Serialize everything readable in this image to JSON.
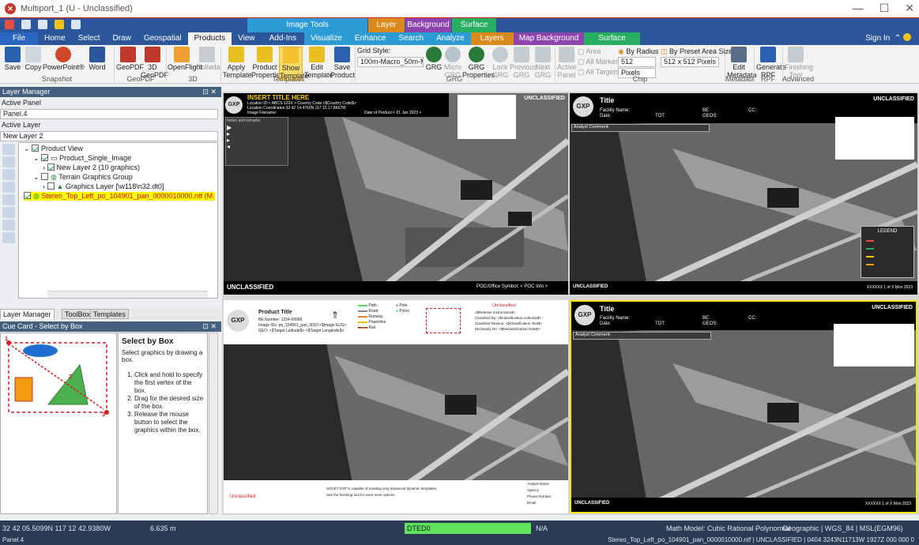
{
  "app": {
    "title": "Multiport_1 (U - Unclassified)"
  },
  "context_groups": [
    {
      "label": "Image Tools",
      "color": "#2d9cd6"
    },
    {
      "label": "Layer Tools",
      "color": "#d98a1a"
    },
    {
      "label": "Background Tools",
      "color": "#8e44ad"
    },
    {
      "label": "Surface Tools",
      "color": "#27ae60"
    }
  ],
  "tabs": [
    "File",
    "Home",
    "Select",
    "Draw",
    "Geospatial",
    "Products",
    "View",
    "Add-Ins",
    "Visualize",
    "Enhance",
    "Search",
    "Analyze",
    "Layers",
    "Map Background",
    "Surface"
  ],
  "sign_in": "Sign In",
  "ribbon": {
    "buttons": {
      "save": "Save",
      "copy": "Copy",
      "powerpoint": "PowerPoint®",
      "word": "Word",
      "geopdf": "GeoPDF",
      "geopdf3d": "3D GeoPDF",
      "openflight": "OpenFlight",
      "collada": "Collada",
      "apply": "Apply Template",
      "product_props": "Product Properties",
      "show_template": "Show Template",
      "edit_template": "Edit Template",
      "save_product": "Save Product",
      "grg": "GRG",
      "micro_grg": "Micro GRG",
      "grg_props": "GRG Properties",
      "lock_grg": "Lock GRG",
      "prev_grg": "Previous GRG",
      "next_grg": "Next GRG",
      "active_panel": "Active Panel",
      "edit_metadata": "Edit Metadata",
      "generate_rpf": "Generate RPF",
      "finishing_tool": "Finishing Tool"
    },
    "grid_style_label": "Grid Style:",
    "grid_style_value": "100m-Macro_50m-Micro",
    "chip": {
      "area": "Area",
      "all_markers": "All Markers",
      "all_targets": "All Targets",
      "by_radius": "By Radius",
      "radius_value": "512",
      "units": "Pixels",
      "by_preset": "By Preset Area Size",
      "preset_value": "512 x 512 Pixels"
    },
    "groups": {
      "snapshot": "Snapshot",
      "geopdf": "GeoPDF",
      "threed": "3D",
      "templates": "Templates",
      "grg": "GRG",
      "chip": "Chip",
      "metadata": "Metadata",
      "rpf": "RPF",
      "advanced": "Advanced"
    }
  },
  "layer_manager": {
    "title": "Layer Manager",
    "active_panel_label": "Active Panel",
    "active_panel_value": "Panel.4",
    "active_layer_label": "Active Layer",
    "active_layer_value": "New Layer 2",
    "tree": [
      "Product View",
      "Product_Single_Image",
      "New Layer 2  (10 graphics)",
      "Terrain Graphics Group",
      "Graphics Layer [\\w118\\n32.dt0]",
      "Stereo_Top_Left_po_104901_pan_0000010000.ntf (M."
    ],
    "tabs": [
      "Layer Manager",
      "ToolBox",
      "Templates"
    ]
  },
  "cue_card": {
    "title": "Cue Card - Select by Box",
    "heading": "Select by Box",
    "intro": "Select graphics by drawing a box.",
    "steps": [
      "Click and hold to specify the first vertex of the box.",
      "Drag for the desired size of the box.",
      "Release the mouse button to select the graphics within the box."
    ]
  },
  "viewports": {
    "tl": {
      "title": "INSERT TITLE HERE",
      "line1": "Location ID:< ABCS-123X >      Country Code:<$Country Code$>",
      "line2": "Location Coordinates:32 42 14.4760N 117 13 17.8667W",
      "line3": "Image Filename:",
      "line4": "Date of Product:< 01 Jan 2023 >",
      "notes": "Notes and remarks",
      "class": "UNCLASSIFIED",
      "bottom_left": "UNCLASSIFIED",
      "poc": "POC/Office Symbol: < POC Info >"
    },
    "tr": {
      "title": "Title",
      "facility": "Facility Name:",
      "date": "Date:",
      "tot": "TOT:",
      "be": "BE:",
      "geos": "GEOS:",
      "cc": "CC:",
      "comment": "Analyst Comment:",
      "class": "UNCLASSIFIED",
      "bottom_left": "UNCLASSIFIED",
      "legend": "LEGEND",
      "page": "XXXXXX 1 of X  Mon 2023"
    },
    "bl": {
      "title": "Product Title",
      "be": "BE Number: 1234-99999",
      "image_id": "Image IDs: po_104901_pan_0010 <$Image EUS>",
      "geo": "GEO: <$Target Latitude$> <$Target Longitude$>",
      "legend": [
        "Path",
        "Road",
        "Runway",
        "Powerline",
        "Rail",
        "Pole",
        "Pylon"
      ],
      "class_red": "Unclassified",
      "rel": "<$Release Instructions$>",
      "classified_by": "Classified By: <$Classification Authority$>",
      "reason": "Classified Reason: <$Classification Text$>",
      "declassify": "Declassify On: <$Declassification Date$>",
      "footer1": "SOCET GXP is capable of creating very advanced dynamic templates.",
      "footer2": "See the finishing tool for even more options.",
      "analyst": [
        "Analyst Name",
        "Agency",
        "Phone Number",
        "Email"
      ],
      "bottom_left": "Unclassified"
    },
    "br": {
      "title": "Title",
      "facility": "Facility Name:",
      "date": "Date:",
      "tot": "TOT:",
      "be": "BE:",
      "geos": "GEOS:",
      "cc": "CC:",
      "comment": "Analyst Comment:",
      "class": "UNCLASSIFIED",
      "bottom_left": "UNCLASSIFIED",
      "page": "XXXXXX 1 of X  Mon 2023"
    }
  },
  "status": {
    "coords": "32 42 05.5099N 117 12 42.9380W",
    "distance": "6.635 m",
    "dted": "DTED0",
    "na": "N/A",
    "math_model": "Math Model: Cubic Rational Polynomial",
    "geo": "Geographic | WGS_84 | MSL(EGM96)",
    "panel": "Panel.4",
    "file": "Stereo_Top_Left_po_104901_pan_0000010000.ntf | UNCLASSIFIED |    0404 3243N11713W 1927Z 000 000 0"
  }
}
